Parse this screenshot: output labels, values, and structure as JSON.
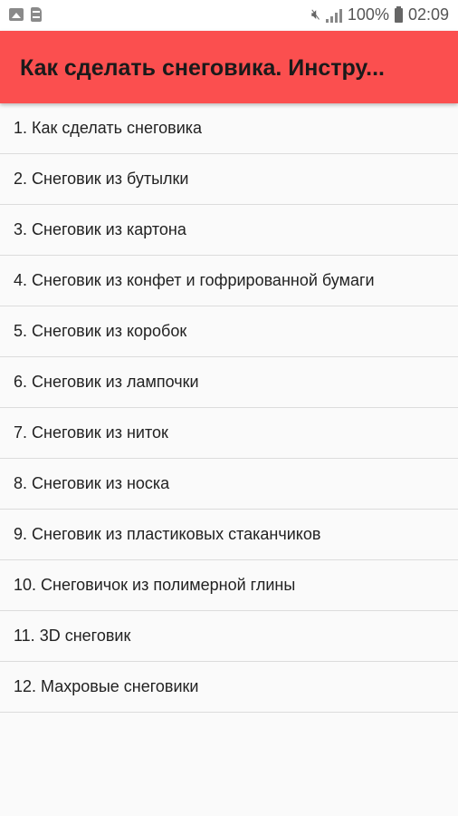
{
  "statusbar": {
    "left_icons": [
      "image-icon",
      "sd-card-icon"
    ],
    "battery": "100%",
    "time": "02:09",
    "right_icons": [
      "mute-icon",
      "signal-icon",
      "battery-icon"
    ]
  },
  "appbar": {
    "title": "Как сделать снеговика. Инстру...",
    "color": "#fb4f4f"
  },
  "list": {
    "items": [
      "1. Как сделать снеговика",
      "2. Снеговик из бутылки",
      "3. Снеговик из картона",
      "4. Снеговик из конфет и гофрированной бумаги",
      "5. Снеговик из коробок",
      "6. Снеговик из лампочки",
      "7. Снеговик из ниток",
      "8. Снеговик из носка",
      "9. Снеговик из пластиковых стаканчиков",
      "10. Снеговичок из полимерной глины",
      "11. 3D снеговик",
      "12. Махровые снеговики"
    ]
  }
}
